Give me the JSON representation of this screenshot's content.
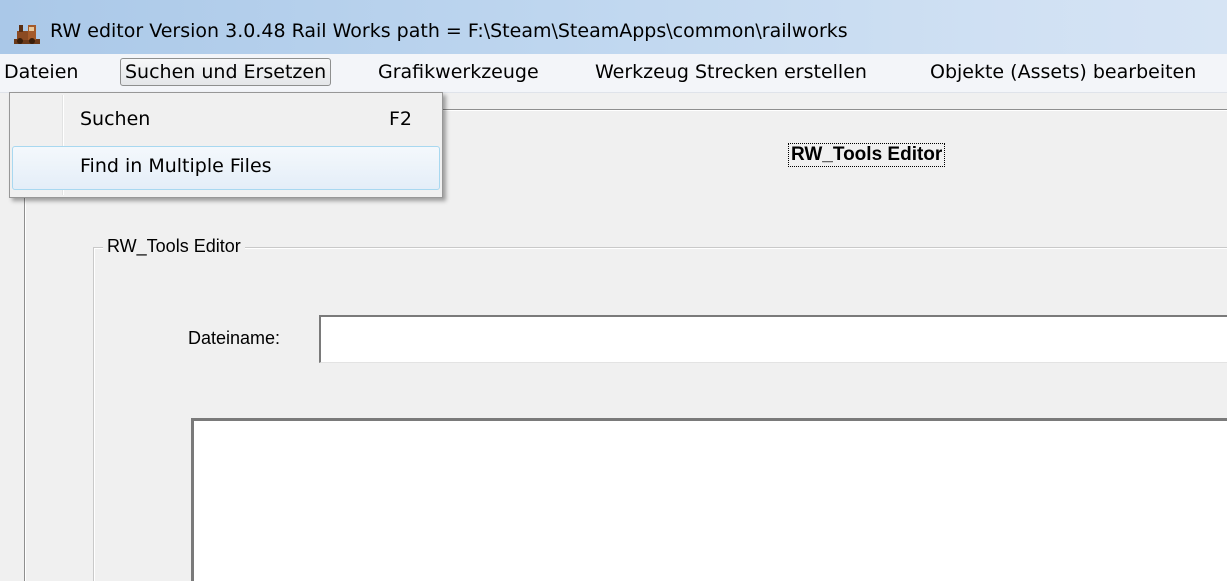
{
  "window": {
    "title": "RW editor  Version 3.0.48   Rail Works path = F:\\Steam\\SteamApps\\common\\railworks",
    "app_icon": "steam-locomotive-icon"
  },
  "menubar": {
    "items": [
      {
        "label": "Dateien"
      },
      {
        "label": "Suchen und Ersetzen",
        "active": true
      },
      {
        "label": "Grafikwerkzeuge"
      },
      {
        "label": "Werkzeug Strecken erstellen"
      },
      {
        "label": "Objekte (Assets) bearbeiten"
      }
    ]
  },
  "dropdown": {
    "items": [
      {
        "label": "Suchen",
        "shortcut": "F2"
      },
      {
        "label": "Find in Multiple Files",
        "shortcut": "",
        "highlighted": true
      }
    ]
  },
  "main": {
    "title": "RW_Tools Editor",
    "group": {
      "label": "RW_Tools Editor",
      "filename_label": "Dateiname:",
      "filename_value": "",
      "text_content": ""
    }
  }
}
